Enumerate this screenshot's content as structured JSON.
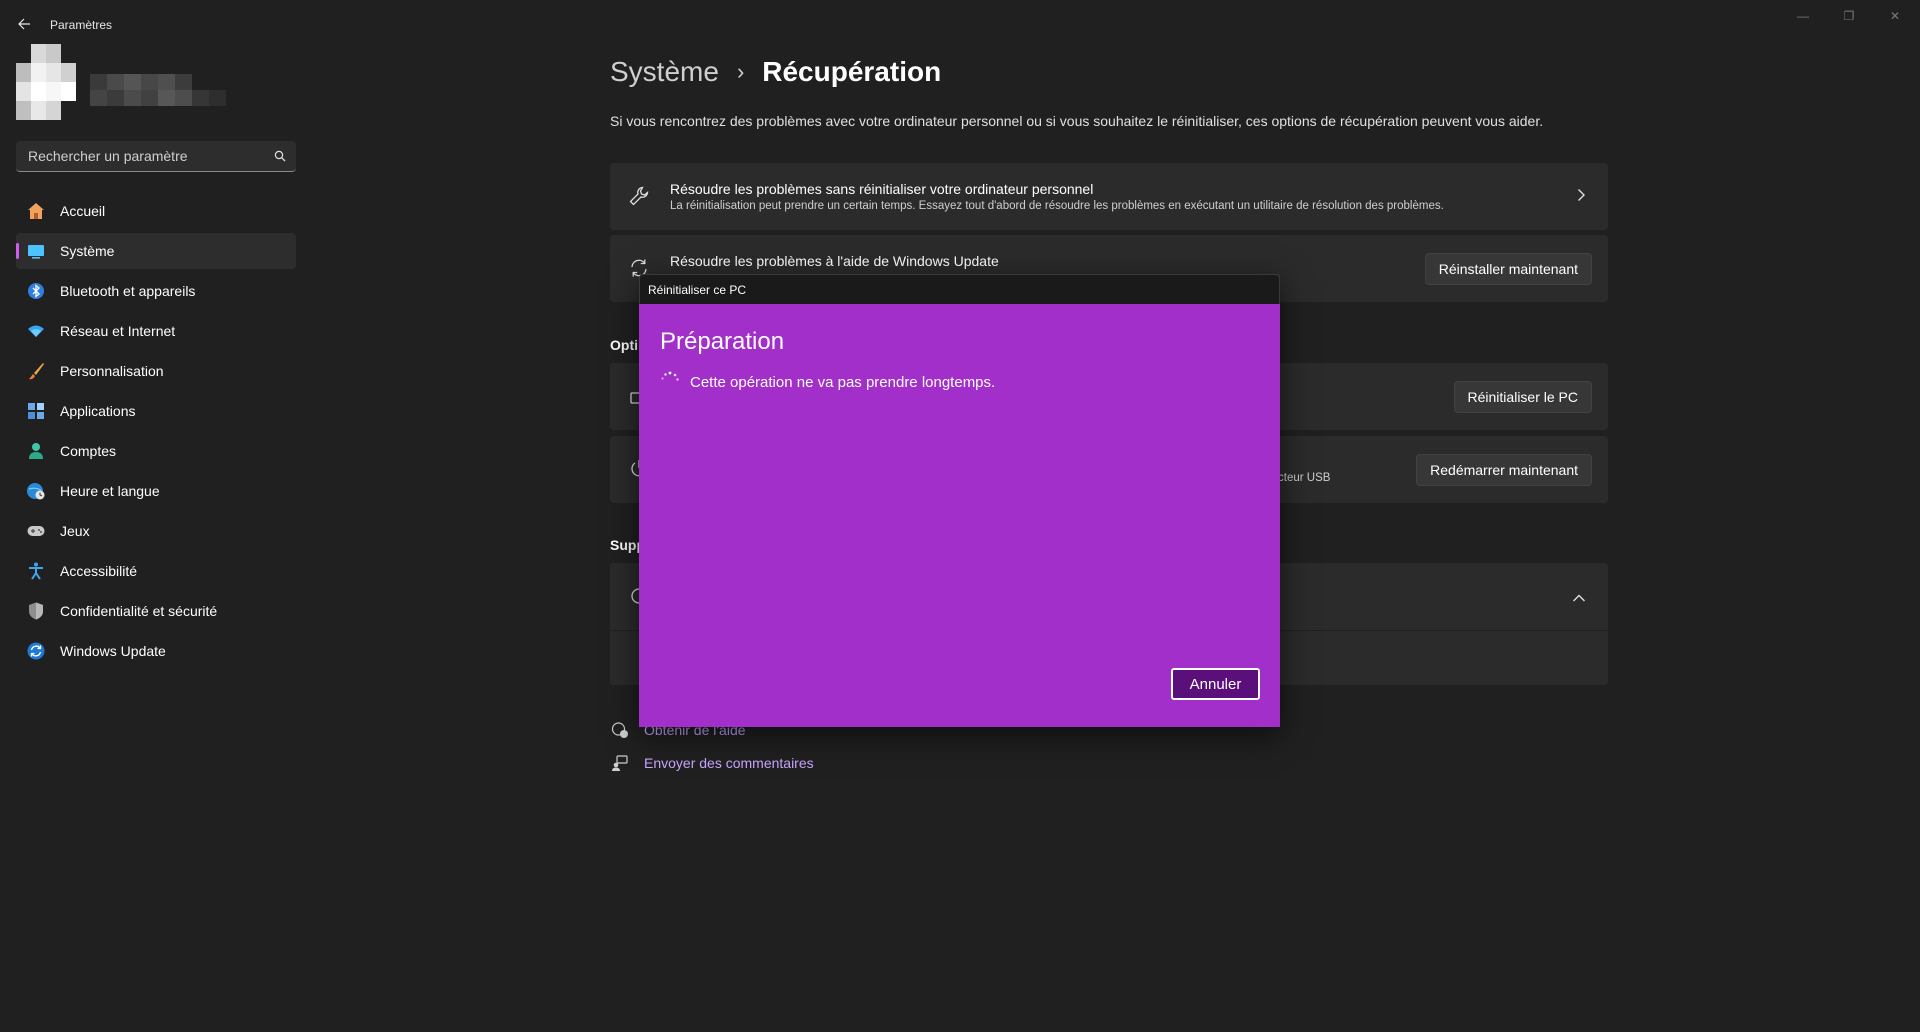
{
  "window": {
    "title": "Paramètres",
    "controls": {
      "minimize": "—",
      "maximize": "❐",
      "close": "✕"
    }
  },
  "search": {
    "placeholder": "Rechercher un paramètre"
  },
  "sidebar": {
    "items": [
      {
        "label": "Accueil",
        "icon": "home-icon",
        "active": false
      },
      {
        "label": "Système",
        "icon": "monitor-icon",
        "active": true
      },
      {
        "label": "Bluetooth et appareils",
        "icon": "bluetooth-icon",
        "active": false
      },
      {
        "label": "Réseau et Internet",
        "icon": "wifi-icon",
        "active": false
      },
      {
        "label": "Personnalisation",
        "icon": "brush-icon",
        "active": false
      },
      {
        "label": "Applications",
        "icon": "apps-icon",
        "active": false
      },
      {
        "label": "Comptes",
        "icon": "person-icon",
        "active": false
      },
      {
        "label": "Heure et langue",
        "icon": "globe-clock-icon",
        "active": false
      },
      {
        "label": "Jeux",
        "icon": "gamepad-icon",
        "active": false
      },
      {
        "label": "Accessibilité",
        "icon": "accessibility-icon",
        "active": false
      },
      {
        "label": "Confidentialité et sécurité",
        "icon": "shield-icon",
        "active": false
      },
      {
        "label": "Windows Update",
        "icon": "update-icon",
        "active": false
      }
    ]
  },
  "main": {
    "breadcrumb": {
      "parent": "Système",
      "separator": "›",
      "current": "Récupération"
    },
    "description": "Si vous rencontrez des problèmes avec votre ordinateur personnel ou si vous souhaitez le réinitialiser, ces options de récupération peuvent vous aider.",
    "troubleshoot": {
      "title": "Résoudre les problèmes sans réinitialiser votre ordinateur personnel",
      "subtitle": "La réinitialisation peut prendre un certain temps. Essayez tout d'abord de résoudre les problèmes en exécutant un utilitaire de résolution des problèmes."
    },
    "windows_update_fix": {
      "title": "Résoudre les problèmes à l'aide de Windows Update",
      "button": "Réinstaller maintenant"
    },
    "options_label": "Opti",
    "reset_pc": {
      "button": "Réinitialiser le PC"
    },
    "advanced_startup": {
      "subtitle_fragment": "cteur USB",
      "button": "Redémarrer maintenant"
    },
    "support_label": "Supp",
    "footer": {
      "get_help": "Obtenir de l'aide",
      "feedback": "Envoyer des commentaires"
    }
  },
  "dialog": {
    "title": "Réinitialiser ce PC",
    "heading": "Préparation",
    "message": "Cette opération ne va pas prendre longtemps.",
    "cancel": "Annuler"
  },
  "colors": {
    "background": "#202020",
    "card": "#2b2b2b",
    "accent": "#d15cf0",
    "dialog_body": "#a22fc9",
    "dialog_button": "#5b0f7a",
    "link": "#c8a6ff"
  }
}
